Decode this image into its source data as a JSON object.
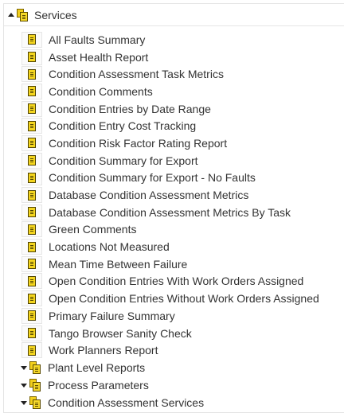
{
  "tree": {
    "root": {
      "label": "Services",
      "expanded": true
    },
    "items": [
      "All Faults Summary",
      "Asset Health Report",
      "Condition Assessment Task Metrics",
      "Condition Comments",
      "Condition Entries by Date Range",
      "Condition Entry Cost Tracking",
      "Condition Risk Factor Rating Report",
      "Condition Summary for Export",
      "Condition Summary for Export - No Faults",
      "Database Condition Assessment Metrics",
      "Database Condition Assessment Metrics By Task",
      "Green Comments",
      "Locations Not Measured",
      "Mean Time Between Failure",
      "Open Condition Entries With Work Orders Assigned",
      "Open Condition Entries Without Work Orders Assigned",
      "Primary Failure Summary",
      "Tango Browser Sanity Check",
      "Work Planners Report"
    ],
    "groups": [
      "Plant Level Reports",
      "Process Parameters",
      "Condition Assessment Services"
    ]
  },
  "icons": {
    "expanded": "triangle-up-icon",
    "collapsed": "triangle-down-icon",
    "folder": "folder-icon",
    "document": "report-document-icon"
  }
}
